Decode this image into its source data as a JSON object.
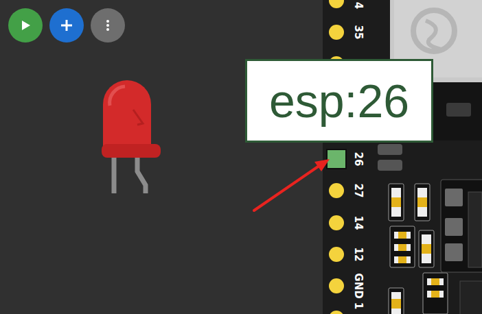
{
  "led": {
    "lit": false
  },
  "pins": [
    {
      "label": "4",
      "selected": false
    },
    {
      "label": "35",
      "selected": false
    },
    {
      "label": "",
      "selected": false
    },
    {
      "label": "",
      "selected": false
    },
    {
      "label": "",
      "selected": false
    },
    {
      "label": "26",
      "selected": true
    },
    {
      "label": "27",
      "selected": false
    },
    {
      "label": "14",
      "selected": false
    },
    {
      "label": "12",
      "selected": false
    },
    {
      "label": "GND",
      "selected": false
    },
    {
      "label": "1",
      "selected": false
    }
  ],
  "tooltip": {
    "text": "esp:26"
  }
}
